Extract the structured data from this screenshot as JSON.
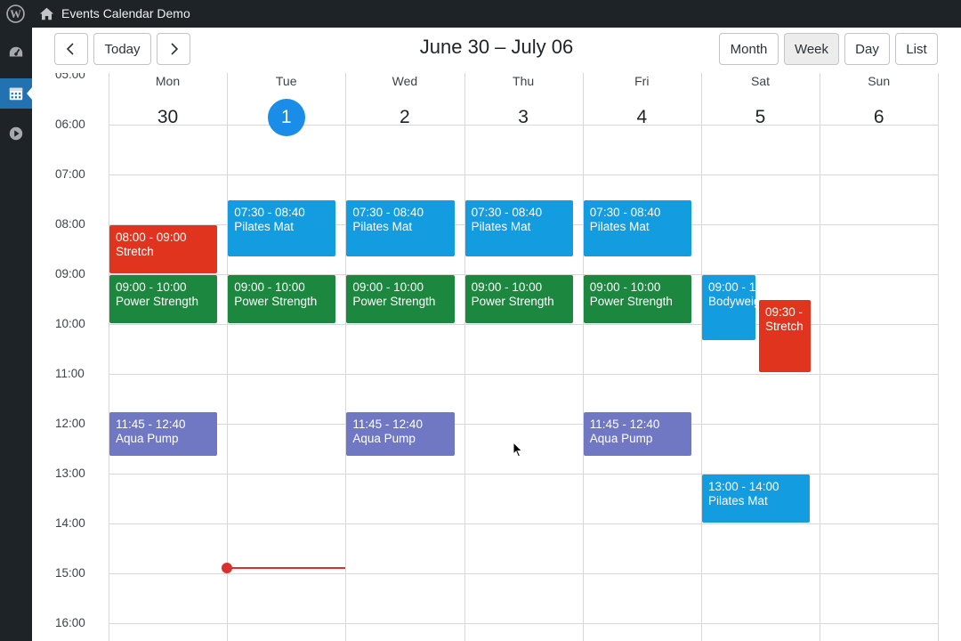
{
  "adminbar": {
    "site_title": "Events Calendar Demo"
  },
  "toolbar": {
    "prev_symbol": "‹",
    "today_label": "Today",
    "next_symbol": "›",
    "title": "June 30 – July 06",
    "views": [
      {
        "label": "Month",
        "active": false
      },
      {
        "label": "Week",
        "active": true
      },
      {
        "label": "Day",
        "active": false
      },
      {
        "label": "List",
        "active": false
      }
    ]
  },
  "time_slots": [
    "05:00",
    "06:00",
    "07:00",
    "08:00",
    "09:00",
    "10:00",
    "11:00",
    "12:00",
    "13:00",
    "14:00",
    "15:00",
    "16:00"
  ],
  "days": [
    {
      "name": "Mon",
      "num": "30",
      "today": false
    },
    {
      "name": "Tue",
      "num": "1",
      "today": true
    },
    {
      "name": "Wed",
      "num": "2",
      "today": false
    },
    {
      "name": "Thu",
      "num": "3",
      "today": false
    },
    {
      "name": "Fri",
      "num": "4",
      "today": false
    },
    {
      "name": "Sat",
      "num": "5",
      "today": false
    },
    {
      "name": "Sun",
      "num": "6",
      "today": false
    }
  ],
  "colors": {
    "stretch": "#e0341e",
    "pilates": "#139ce0",
    "power": "#1b873f",
    "aqua": "#7078c4",
    "bodyweight": "#139ce0",
    "now": "#dc2f2f"
  },
  "events": [
    {
      "day": 0,
      "start": 8.0,
      "end": 9.0,
      "time": "08:00 - 09:00",
      "title": "Stretch",
      "color": "stretch"
    },
    {
      "day": 0,
      "start": 9.0,
      "end": 10.0,
      "time": "09:00 - 10:00",
      "title": "Power Strength",
      "color": "power"
    },
    {
      "day": 0,
      "start": 11.75,
      "end": 12.667,
      "time": "11:45 - 12:40",
      "title": "Aqua Pump",
      "color": "aqua"
    },
    {
      "day": 1,
      "start": 7.5,
      "end": 8.667,
      "time": "07:30 - 08:40",
      "title": "Pilates Mat",
      "color": "pilates"
    },
    {
      "day": 1,
      "start": 9.0,
      "end": 10.0,
      "time": "09:00 - 10:00",
      "title": "Power Strength",
      "color": "power"
    },
    {
      "day": 2,
      "start": 7.5,
      "end": 8.667,
      "time": "07:30 - 08:40",
      "title": "Pilates Mat",
      "color": "pilates"
    },
    {
      "day": 2,
      "start": 9.0,
      "end": 10.0,
      "time": "09:00 - 10:00",
      "title": "Power Strength",
      "color": "power"
    },
    {
      "day": 2,
      "start": 11.75,
      "end": 12.667,
      "time": "11:45 - 12:40",
      "title": "Aqua Pump",
      "color": "aqua"
    },
    {
      "day": 3,
      "start": 7.5,
      "end": 8.667,
      "time": "07:30 - 08:40",
      "title": "Pilates Mat",
      "color": "pilates"
    },
    {
      "day": 3,
      "start": 9.0,
      "end": 10.0,
      "time": "09:00 - 10:00",
      "title": "Power Strength",
      "color": "power"
    },
    {
      "day": 4,
      "start": 7.5,
      "end": 8.667,
      "time": "07:30 - 08:40",
      "title": "Pilates Mat",
      "color": "pilates"
    },
    {
      "day": 4,
      "start": 9.0,
      "end": 10.0,
      "time": "09:00 - 10:00",
      "title": "Power Strength",
      "color": "power"
    },
    {
      "day": 4,
      "start": 11.75,
      "end": 12.667,
      "time": "11:45 - 12:40",
      "title": "Aqua Pump",
      "color": "aqua"
    },
    {
      "day": 5,
      "start": 9.0,
      "end": 10.333,
      "time": "09:00 - 1",
      "title": "Bodyweig",
      "color": "bodyweight",
      "column": 0
    },
    {
      "day": 5,
      "start": 9.5,
      "end": 10.983,
      "time": "09:30 -",
      "title": "Stretch",
      "color": "stretch",
      "column": 1
    },
    {
      "day": 5,
      "start": 13.0,
      "end": 14.0,
      "time": "13:00 - 14:00",
      "title": "Pilates Mat",
      "color": "pilates"
    }
  ],
  "now_indicator": {
    "day": 1,
    "hour": 14.9
  }
}
